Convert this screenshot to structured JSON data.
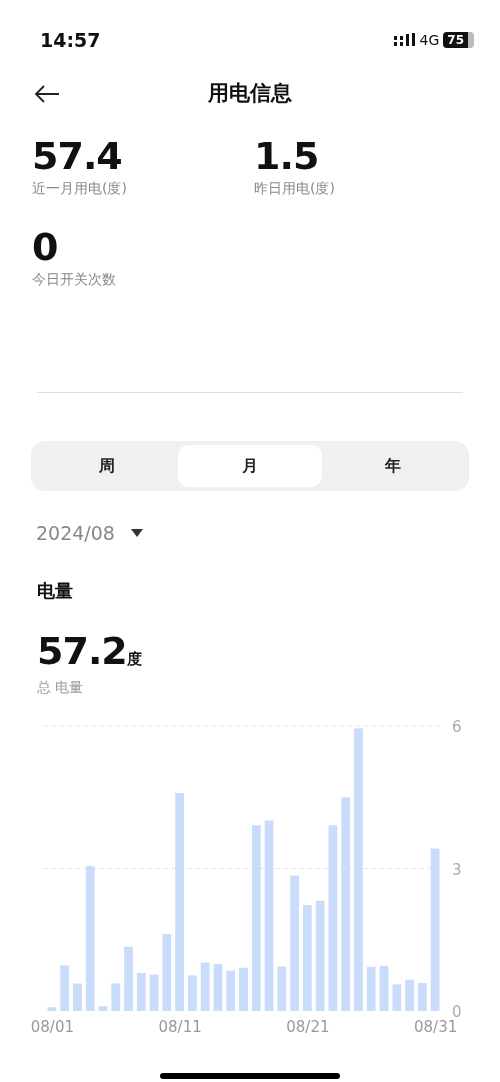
{
  "status_bar": {
    "time": "14:57",
    "network": "4G",
    "battery": "75"
  },
  "header": {
    "title": "用电信息"
  },
  "stats": [
    {
      "value": "57.4",
      "label": "近一月用电(度)"
    },
    {
      "value": "1.5",
      "label": "昨日用电(度)"
    },
    {
      "value": "0",
      "label": "今日开关次数"
    }
  ],
  "tabs": [
    {
      "label": "周",
      "selected": false
    },
    {
      "label": "月",
      "selected": true
    },
    {
      "label": "年",
      "selected": false
    }
  ],
  "period": "2024/08",
  "section_title": "电量",
  "total": {
    "value": "57.2",
    "unit": "度",
    "label": "总 电量"
  },
  "chart": {
    "chart_data": {
      "type": "bar",
      "categories": [
        "08/01",
        null,
        null,
        null,
        null,
        null,
        null,
        null,
        null,
        null,
        "08/11",
        null,
        null,
        null,
        null,
        null,
        null,
        null,
        null,
        null,
        "08/21",
        null,
        null,
        null,
        null,
        null,
        null,
        null,
        null,
        null,
        "08/31"
      ],
      "series": [
        {
          "color": "#c9dcfb",
          "values": [
            0.08,
            0.96,
            0.58,
            3.05,
            0.1,
            0.58,
            1.35,
            0.8,
            0.77,
            1.62,
            4.59,
            0.75,
            1.02,
            0.99,
            0.85,
            0.91,
            3.91,
            4.01,
            0.94,
            2.85,
            2.23,
            2.32,
            3.91,
            4.5,
            5.95,
            0.93,
            0.95,
            0.56,
            0.66,
            0.59,
            3.42
          ]
        }
      ],
      "ylim": [
        0,
        6
      ],
      "yticks": [
        0,
        3,
        6
      ]
    }
  }
}
